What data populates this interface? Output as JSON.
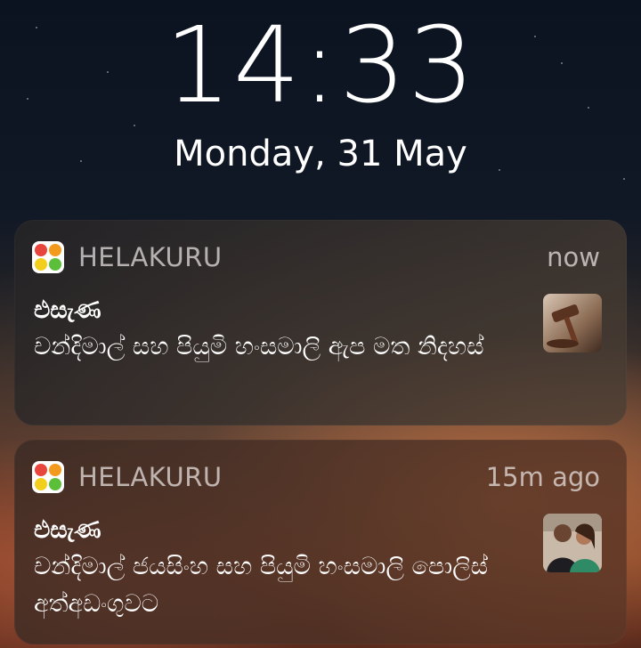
{
  "lockscreen": {
    "time": "14:33",
    "date": "Monday, 31 May"
  },
  "notifications": [
    {
      "app_name": "HELAKURU",
      "time": "now",
      "title": "එසැණ",
      "body": "චන්දිමාල් සහ පියුමි හංසමාලි ඇප මත නිදහස්",
      "thumbnail_icon": "gavel-image"
    },
    {
      "app_name": "HELAKURU",
      "time": "15m ago",
      "title": "එසැණ",
      "body": "චන්දිමාල් ජයසිංහ සහ පියුමි හංසමාලි පොලිස් අත්අඩංගුවට",
      "thumbnail_icon": "people-photo"
    }
  ],
  "colors": {
    "icon_red": "#e8453c",
    "icon_orange": "#f39a1e",
    "icon_yellow": "#f2cf1d",
    "icon_green": "#5bbf3a"
  }
}
